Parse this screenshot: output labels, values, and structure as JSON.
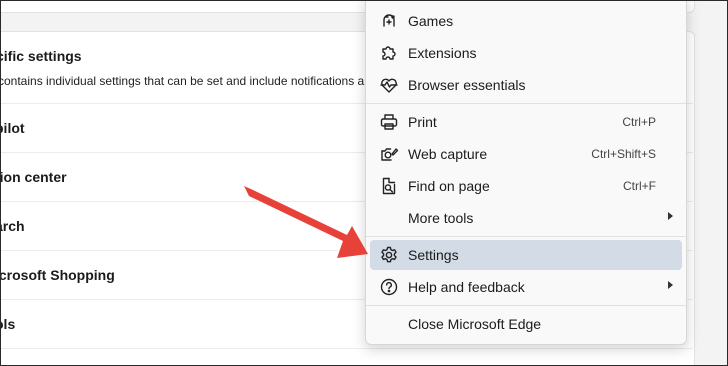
{
  "settings_page": {
    "section_title": "cific settings",
    "section_desc": "contains individual settings that can be set and include notifications a",
    "rows": [
      {
        "label": "pilot"
      },
      {
        "label": "tion center"
      },
      {
        "label": "arch"
      },
      {
        "label": "icrosoft Shopping"
      },
      {
        "label": "ols"
      }
    ]
  },
  "menu": {
    "items": [
      {
        "label": "Games",
        "icon": "games-icon"
      },
      {
        "label": "Extensions",
        "icon": "extensions-icon"
      },
      {
        "label": "Browser essentials",
        "icon": "heart-pulse-icon"
      },
      {
        "label": "Print",
        "shortcut": "Ctrl+P",
        "icon": "printer-icon"
      },
      {
        "label": "Web capture",
        "shortcut": "Ctrl+Shift+S",
        "icon": "web-capture-icon"
      },
      {
        "label": "Find on page",
        "shortcut": "Ctrl+F",
        "icon": "find-on-page-icon"
      },
      {
        "label": "More tools",
        "submenu": true
      },
      {
        "label": "Settings",
        "icon": "gear-icon",
        "highlighted": true
      },
      {
        "label": "Help and feedback",
        "icon": "help-icon",
        "submenu": true
      },
      {
        "label": "Close Microsoft Edge"
      }
    ]
  },
  "annotation": {
    "arrow_color": "#e8413a"
  },
  "colors": {
    "highlight": "#d3dce6",
    "menu_bg": "#f9f9f9"
  }
}
